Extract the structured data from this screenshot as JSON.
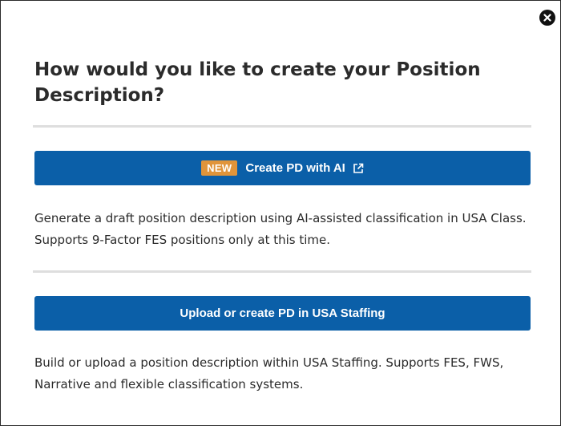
{
  "dialog": {
    "title": "How would you like to create your Position Description?",
    "close_icon": "close-icon"
  },
  "option_ai": {
    "badge": "NEW",
    "label": "Create PD with AI",
    "icon": "external-link-icon",
    "description": "Generate a draft position description using AI-assisted classification in USA Class. Supports 9-Factor FES positions only at this time."
  },
  "option_staffing": {
    "label": "Upload or create PD in USA Staffing",
    "description": "Build or upload a position description within USA Staffing. Supports FES, FWS, Narrative and flexible classification systems."
  },
  "colors": {
    "button_bg": "#0b5fa8",
    "badge_bg": "#e0943a",
    "divider": "#dedede",
    "text": "#2b2b2b"
  }
}
